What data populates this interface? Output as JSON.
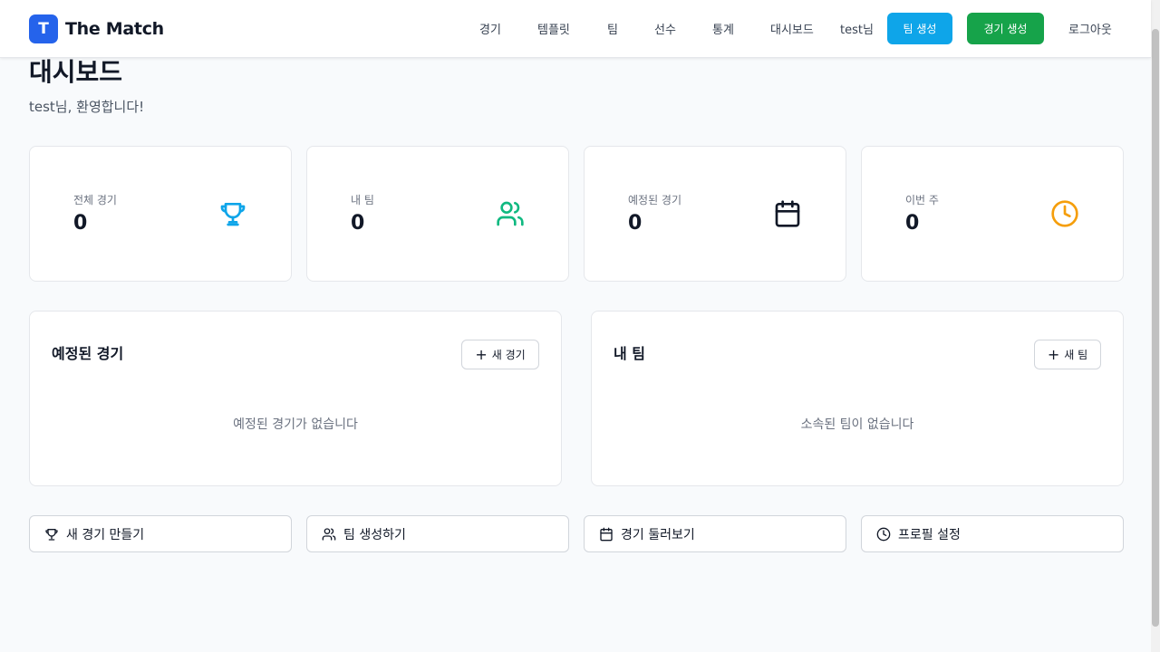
{
  "header": {
    "logo_letter": "T",
    "app_name": "The Match",
    "nav": [
      "경기",
      "템플릿",
      "팀",
      "선수",
      "통계",
      "대시보드"
    ],
    "user": "test님",
    "team_create": "팀 생성",
    "match_create": "경기 생성",
    "logout": "로그아웃"
  },
  "page": {
    "title": "대시보드",
    "welcome": "test님, 환영합니다!"
  },
  "stats": [
    {
      "label": "전체 경기",
      "value": "0",
      "icon": "trophy-icon",
      "color": "#0ea5e9"
    },
    {
      "label": "내 팀",
      "value": "0",
      "icon": "users-icon",
      "color": "#10b981"
    },
    {
      "label": "예정된 경기",
      "value": "0",
      "icon": "calendar-icon",
      "color": "#111827"
    },
    {
      "label": "이번 주",
      "value": "0",
      "icon": "clock-icon",
      "color": "#f59e0b"
    }
  ],
  "panels": {
    "upcoming": {
      "title": "예정된 경기",
      "button": "새 경기",
      "empty": "예정된 경기가 없습니다"
    },
    "teams": {
      "title": "내 팀",
      "button": "새 팀",
      "empty": "소속된 팀이 없습니다"
    }
  },
  "quick_actions": [
    {
      "label": "새 경기 만들기",
      "icon": "trophy-icon"
    },
    {
      "label": "팀 생성하기",
      "icon": "users-icon"
    },
    {
      "label": "경기 둘러보기",
      "icon": "calendar-icon"
    },
    {
      "label": "프로필 설정",
      "icon": "clock-icon"
    }
  ]
}
